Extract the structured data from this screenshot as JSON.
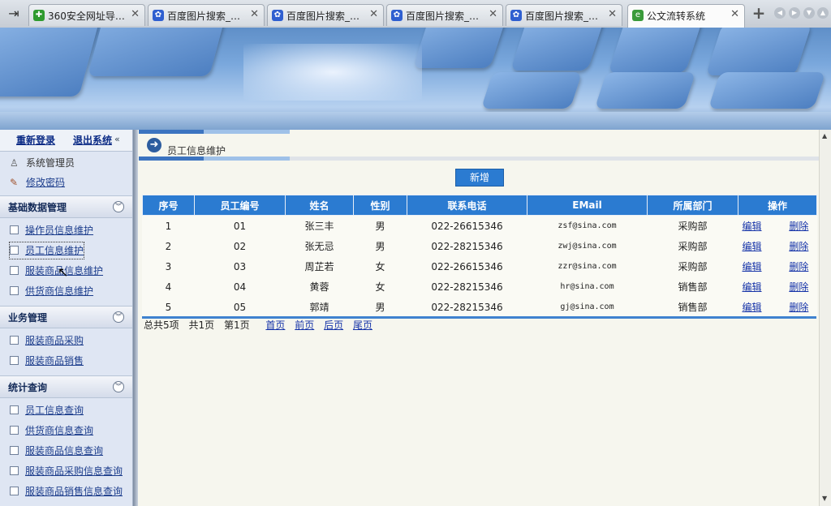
{
  "browser": {
    "tabs": [
      {
        "title": "360安全网址导…",
        "favicon_color": "#2f9b2f",
        "active": false
      },
      {
        "title": "百度图片搜索_…",
        "favicon_color": "#2f5fd0",
        "active": false
      },
      {
        "title": "百度图片搜索_…",
        "favicon_color": "#2f5fd0",
        "active": false
      },
      {
        "title": "百度图片搜索_…",
        "favicon_color": "#2f5fd0",
        "active": false
      },
      {
        "title": "百度图片搜索_…",
        "favicon_color": "#2f5fd0",
        "active": false
      },
      {
        "title": "公文流转系统",
        "favicon_color": "#3a9a3a",
        "active": true
      }
    ],
    "close_glyph": "✕",
    "new_tab_glyph": "+"
  },
  "sidebar": {
    "relogin": "重新登录",
    "logout": "退出系统",
    "user": "系统管理员",
    "change_password": "修改密码",
    "sections": [
      {
        "title": "基础数据管理",
        "items": [
          "操作员信息维护",
          "员工信息维护",
          "服装商品信息维护",
          "供货商信息维护"
        ]
      },
      {
        "title": "业务管理",
        "items": [
          "服装商品采购",
          "服装商品销售"
        ]
      },
      {
        "title": "统计查询",
        "items": [
          "员工信息查询",
          "供货商信息查询",
          "服装商品信息查询",
          "服装商品采购信息查询",
          "服装商品销售信息查询"
        ]
      }
    ]
  },
  "main": {
    "page_title": "员工信息维护",
    "add_button": "新增",
    "table": {
      "headers": [
        "序号",
        "员工编号",
        "姓名",
        "性别",
        "联系电话",
        "EMail",
        "所属部门",
        "操作"
      ],
      "rows": [
        {
          "no": "1",
          "id": "01",
          "name": "张三丰",
          "gender": "男",
          "phone": "022-26615346",
          "email": "zsf@sina.com",
          "dept": "采购部"
        },
        {
          "no": "2",
          "id": "02",
          "name": "张无忌",
          "gender": "男",
          "phone": "022-28215346",
          "email": "zwj@sina.com",
          "dept": "采购部"
        },
        {
          "no": "3",
          "id": "03",
          "name": "周芷若",
          "gender": "女",
          "phone": "022-26615346",
          "email": "zzr@sina.com",
          "dept": "采购部"
        },
        {
          "no": "4",
          "id": "04",
          "name": "黄蓉",
          "gender": "女",
          "phone": "022-28215346",
          "email": "hr@sina.com",
          "dept": "销售部"
        },
        {
          "no": "5",
          "id": "05",
          "name": "郭靖",
          "gender": "男",
          "phone": "022-28215346",
          "email": "gj@sina.com",
          "dept": "销售部"
        }
      ],
      "edit_label": "编辑",
      "delete_label": "删除"
    },
    "pager": {
      "total": "总共5项",
      "pages": "共1页",
      "current": "第1页",
      "first": "首页",
      "prev": "前页",
      "next": "后页",
      "last": "尾页"
    }
  },
  "colors": {
    "accent": "#2b7bd1",
    "link": "#1533a8",
    "content_bg": "#f6f6ee",
    "sidebar_bg": "#dfe6f3"
  }
}
